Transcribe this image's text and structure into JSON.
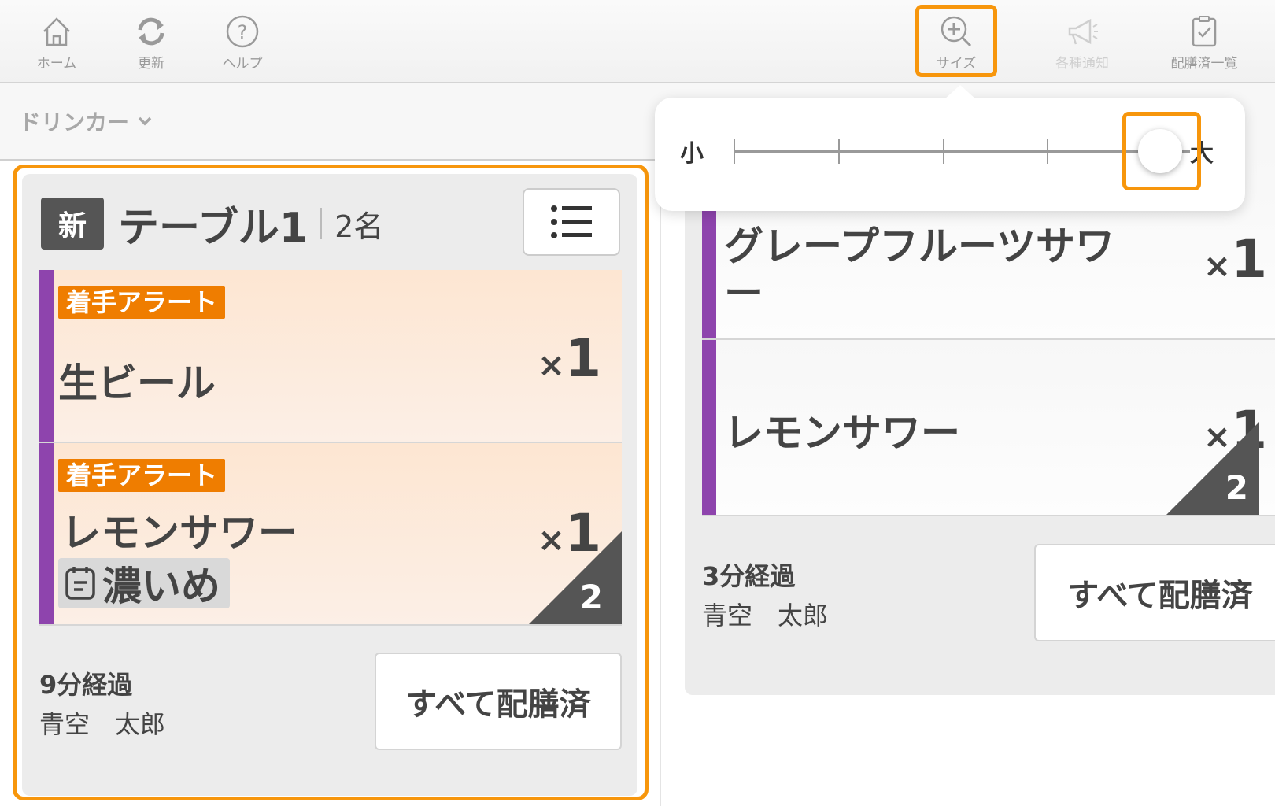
{
  "toolbar": {
    "home": "ホーム",
    "refresh": "更新",
    "help": "ヘルプ",
    "size": "サイズ",
    "notifications": "各種通知",
    "served_list": "配膳済一覧"
  },
  "department": {
    "label": "ドリンカー"
  },
  "size_popup": {
    "small_label": "小",
    "large_label": "大",
    "level": 4,
    "levels": 5
  },
  "order_left": {
    "new_badge": "新",
    "table": "テーブル1",
    "guests": "2名",
    "items": [
      {
        "alert": "着手アラート",
        "name": "生ビール",
        "qty_x": "×",
        "qty": "1"
      },
      {
        "alert": "着手アラート",
        "name": "レモンサワー",
        "qty_x": "×",
        "qty": "1",
        "option": "濃いめ",
        "corner": "2"
      }
    ],
    "elapsed": "9分経過",
    "staff": "青空　太郎",
    "serve_all": "すべて配膳済"
  },
  "order_right": {
    "items": [
      {
        "name_line1": "グレープフルーツサワ",
        "name_line2": "ー",
        "qty_x": "×",
        "qty": "1"
      },
      {
        "name": "レモンサワー",
        "qty_x": "×",
        "qty": "1",
        "corner": "2"
      }
    ],
    "elapsed": "3分経過",
    "staff": "青空　太郎",
    "serve_all": "すべて配膳済"
  },
  "colors": {
    "accent": "#f7960c",
    "alert": "#ef7d00",
    "item_bar": "#8e44ad",
    "alert_row_bg": "#fde9d9"
  }
}
